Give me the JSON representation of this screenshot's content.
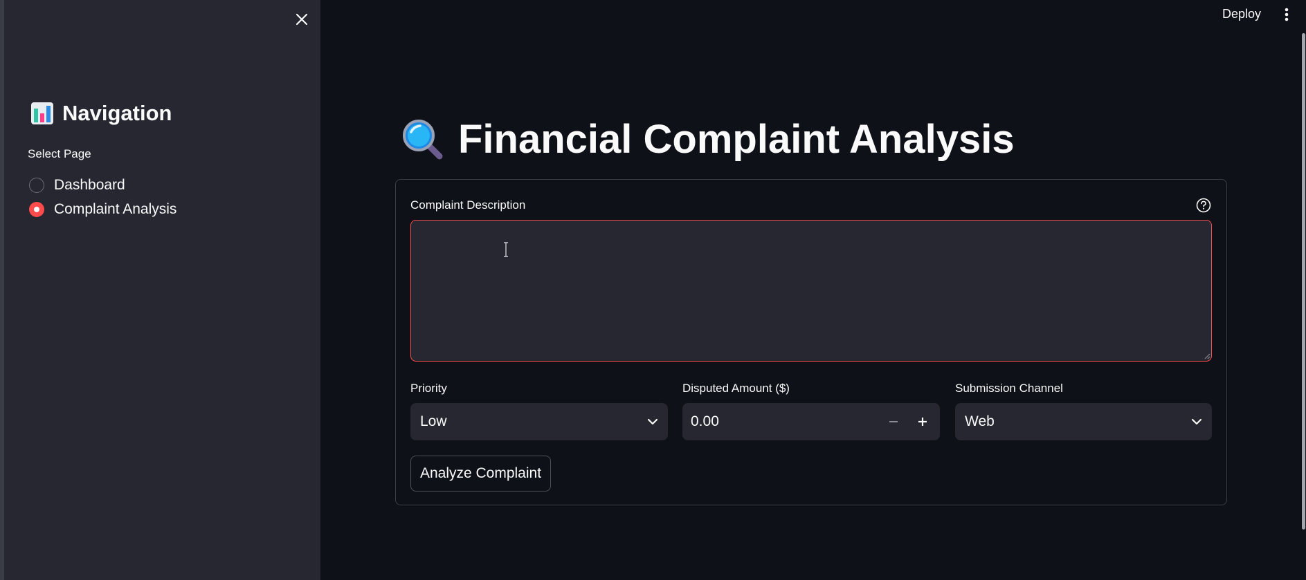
{
  "sidebar": {
    "title": "Navigation",
    "title_icon": "bar-chart-icon",
    "select_label": "Select Page",
    "options": [
      {
        "label": "Dashboard",
        "selected": false
      },
      {
        "label": "Complaint Analysis",
        "selected": true
      }
    ],
    "close_icon": "close-icon"
  },
  "header": {
    "deploy_label": "Deploy",
    "menu_icon": "vertical-dots-icon"
  },
  "main": {
    "title": "Financial Complaint Analysis",
    "title_icon": "magnifying-glass-icon",
    "description": {
      "label": "Complaint Description",
      "value": "",
      "help_icon": "question-circle-icon"
    },
    "priority": {
      "label": "Priority",
      "value": "Low"
    },
    "amount": {
      "label": "Disputed Amount ($)",
      "value": "0.00",
      "minus": "−",
      "plus": "+"
    },
    "channel": {
      "label": "Submission Channel",
      "value": "Web"
    },
    "submit_label": "Analyze Complaint"
  },
  "colors": {
    "accent": "#ff4b4b",
    "background": "#0e1117",
    "sidebar": "#262730",
    "field": "#262730"
  }
}
